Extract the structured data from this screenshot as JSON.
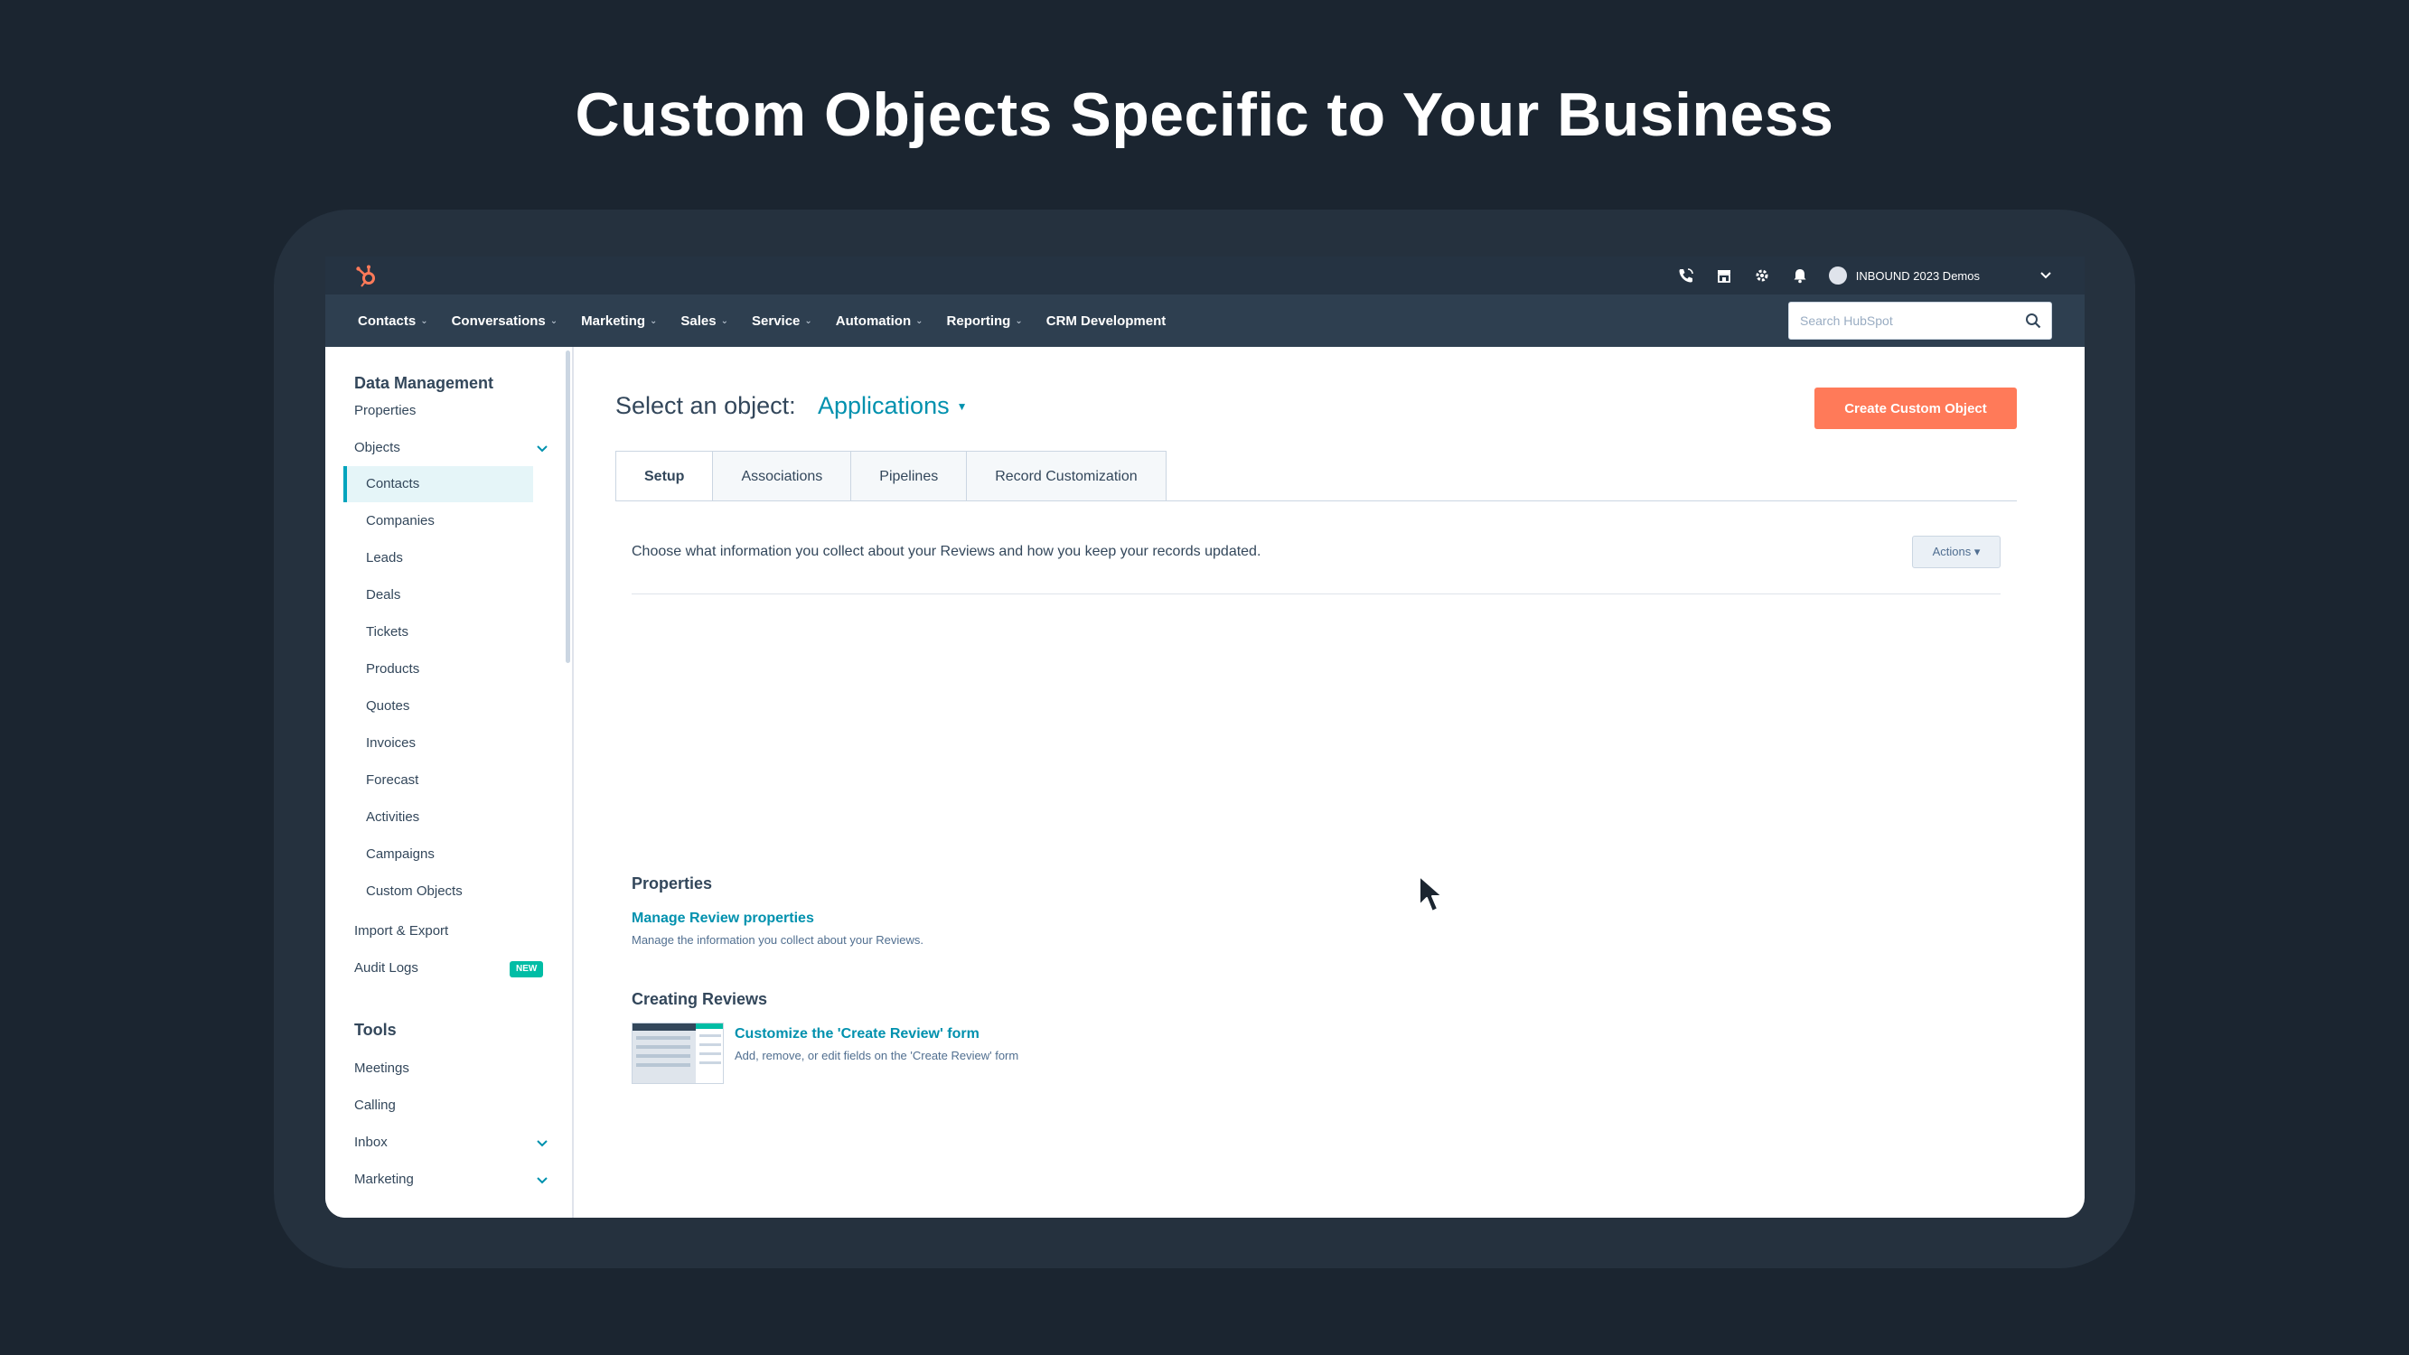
{
  "slide": {
    "title": "Custom Objects Specific to Your Business"
  },
  "topbar": {
    "account_name": "INBOUND 2023 Demos",
    "icons": [
      "phone-icon",
      "marketplace-icon",
      "gear-icon",
      "bell-icon",
      "chevron-down-icon"
    ]
  },
  "nav": {
    "items": [
      {
        "label": "Contacts",
        "has_dropdown": true
      },
      {
        "label": "Conversations",
        "has_dropdown": true
      },
      {
        "label": "Marketing",
        "has_dropdown": true
      },
      {
        "label": "Sales",
        "has_dropdown": true
      },
      {
        "label": "Service",
        "has_dropdown": true
      },
      {
        "label": "Automation",
        "has_dropdown": true
      },
      {
        "label": "Reporting",
        "has_dropdown": true
      },
      {
        "label": "CRM Development",
        "has_dropdown": false
      }
    ],
    "search_placeholder": "Search HubSpot"
  },
  "sidebar": {
    "data_management_heading": "Data Management",
    "properties": "Properties",
    "objects": "Objects",
    "object_items": [
      "Contacts",
      "Companies",
      "Leads",
      "Deals",
      "Tickets",
      "Products",
      "Quotes",
      "Invoices",
      "Forecast",
      "Activities",
      "Campaigns",
      "Custom Objects"
    ],
    "active_object": "Contacts",
    "import_export": "Import & Export",
    "audit_logs": "Audit Logs",
    "audit_logs_badge": "NEW",
    "tools_heading": "Tools",
    "meetings": "Meetings",
    "calling": "Calling",
    "inbox": "Inbox",
    "marketing": "Marketing"
  },
  "main": {
    "object_label": "Select an object:",
    "object_selected": "Applications",
    "create_button": "Create Custom Object",
    "tabs": [
      "Setup",
      "Associations",
      "Pipelines",
      "Record Customization"
    ],
    "active_tab": "Setup",
    "setup_description": "Choose what information you collect about your Reviews and how you keep your records updated.",
    "actions_button": "Actions",
    "properties_heading": "Properties",
    "manage_properties_link": "Manage Review properties",
    "manage_properties_desc": "Manage the information you collect about your Reviews.",
    "creating_heading": "Creating Reviews",
    "customize_form_link": "Customize the 'Create Review' form",
    "customize_form_desc": "Add, remove, or edit fields on the 'Create Review' form"
  },
  "colors": {
    "background": "#1b2530",
    "device": "#25313e",
    "nav": "#2e3f50",
    "accent_orange": "#ff7a59",
    "link_teal": "#0091ae",
    "active_item": "#00a4bd",
    "badge_green": "#00bda5"
  }
}
